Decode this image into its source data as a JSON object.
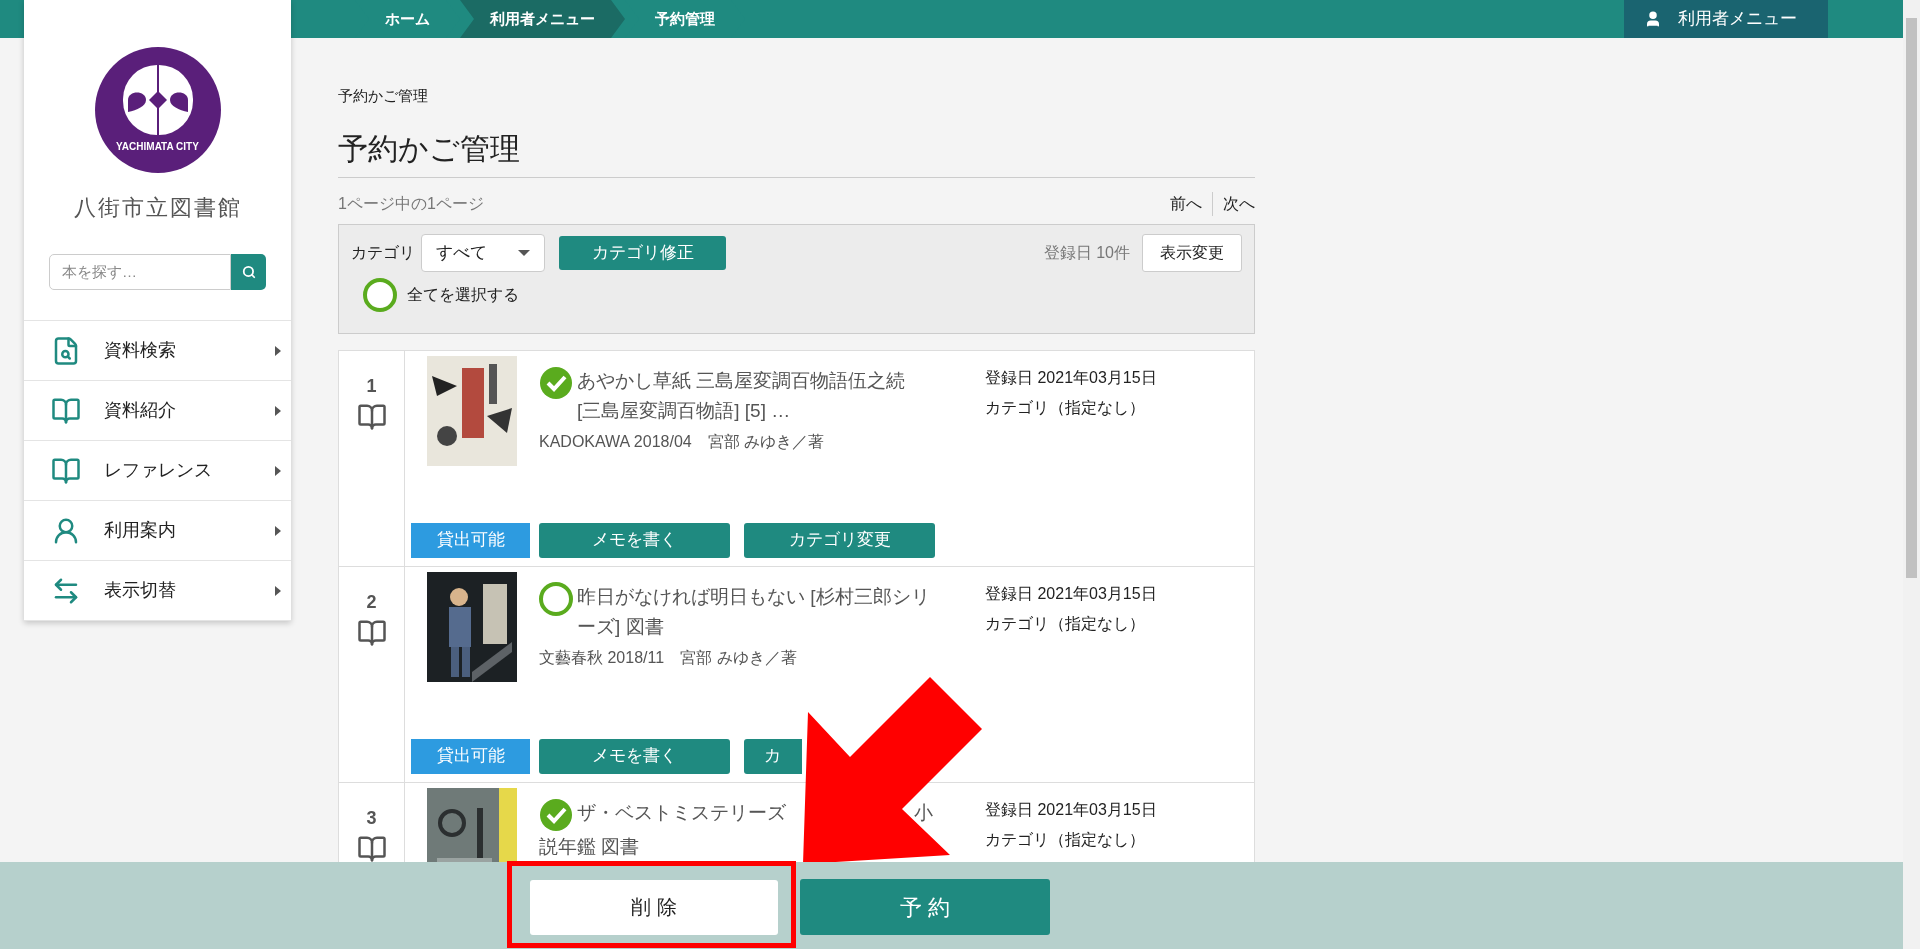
{
  "top_bar": {
    "breadcrumbs": [
      {
        "label": "ホーム",
        "selected": false
      },
      {
        "label": "利用者メニュー",
        "selected": true
      },
      {
        "label": "予約管理",
        "selected": false
      }
    ],
    "user_menu": "利用者メニュー"
  },
  "sidebar": {
    "logo_text": "YACHIMATA CITY",
    "library_name": "八街市立図書館",
    "search": {
      "placeholder": "本を探す…"
    },
    "items": [
      {
        "label": "資料検索",
        "kind": "search"
      },
      {
        "label": "資料紹介",
        "kind": "book"
      },
      {
        "label": "レファレンス",
        "kind": "book"
      },
      {
        "label": "利用案内",
        "kind": "person"
      },
      {
        "label": "表示切替",
        "kind": "swap"
      }
    ]
  },
  "page": {
    "breadcrumb": "予約かご管理",
    "title": "予約かご管理",
    "page_info": "1ページ中の1ページ",
    "prev": "前へ",
    "next": "次へ"
  },
  "filter": {
    "label": "カテゴリ",
    "select_value": "すべて",
    "category_button": "カテゴリ修正",
    "sort_info": "登録日 10件",
    "display_button": "表示変更",
    "select_all": {
      "label": "全てを選択する",
      "checked": false
    }
  },
  "items": [
    {
      "number": "1",
      "checked": true,
      "title": "あやかし草紙 三島屋変調百物語伍之続 [三島屋変調百物語] [5] …",
      "meta": "KADOKAWA 2018/04　宮部 みゆき／著",
      "registered": "登録日 2021年03月15日",
      "category": "カテゴリ（指定なし）",
      "status": "貸出可能",
      "buttons": [
        {
          "label": "メモを書く",
          "clipped": false
        },
        {
          "label": "カテゴリ変更",
          "clipped": false
        }
      ]
    },
    {
      "number": "2",
      "checked": false,
      "title": "昨日がなければ明日もない [杉村三郎シリーズ] 図書",
      "meta": "文藝春秋 2018/11　宮部 みゆき／著",
      "registered": "登録日 2021年03月15日",
      "category": "カテゴリ（指定なし）",
      "status": "貸出可能",
      "buttons": [
        {
          "label": "メモを書く",
          "clipped": false
        },
        {
          "label": "カ",
          "clipped": true
        }
      ]
    },
    {
      "number": "3",
      "checked": true,
      "title": "ザ・ベストミステリーズ",
      "title_after_gap": "小",
      "title_line_2": "説年鑑 図書",
      "registered": "登録日 2021年03月15日",
      "category": "カテゴリ（指定なし）"
    }
  ],
  "footer": {
    "delete_button": "削 除",
    "reserve_button": "予 約"
  }
}
